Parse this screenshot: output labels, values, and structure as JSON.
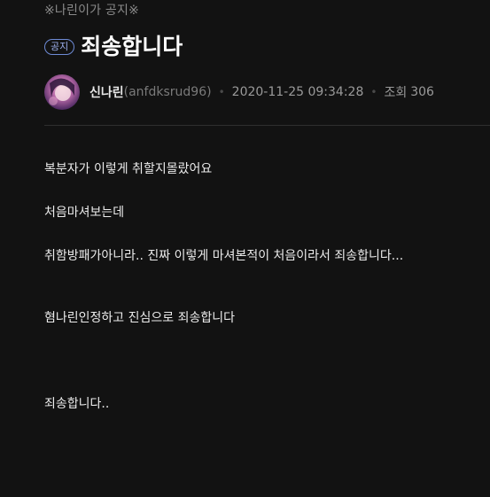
{
  "post": {
    "board_name": "※나린이가 공지※",
    "tag": "공지",
    "title": "죄송합니다",
    "author": {
      "nickname": "신나린",
      "id": "(anfdksrud96)"
    },
    "date": "2020-11-25 09:34:28",
    "views_label": "조회",
    "views": "306",
    "paragraphs": [
      "복분자가 이렇게 취할지몰랐어요",
      "처음마셔보는데",
      "취함방패가아니라.. 진짜 이렇게 마셔본적이 처음이라서 죄송합니다...",
      "혐나린인정하고 진심으로 죄송합니다",
      "죄송합니다.."
    ]
  },
  "colors": {
    "background": "#121212",
    "tag_border": "#6e8bd6",
    "muted_text": "#8a8a8a"
  }
}
